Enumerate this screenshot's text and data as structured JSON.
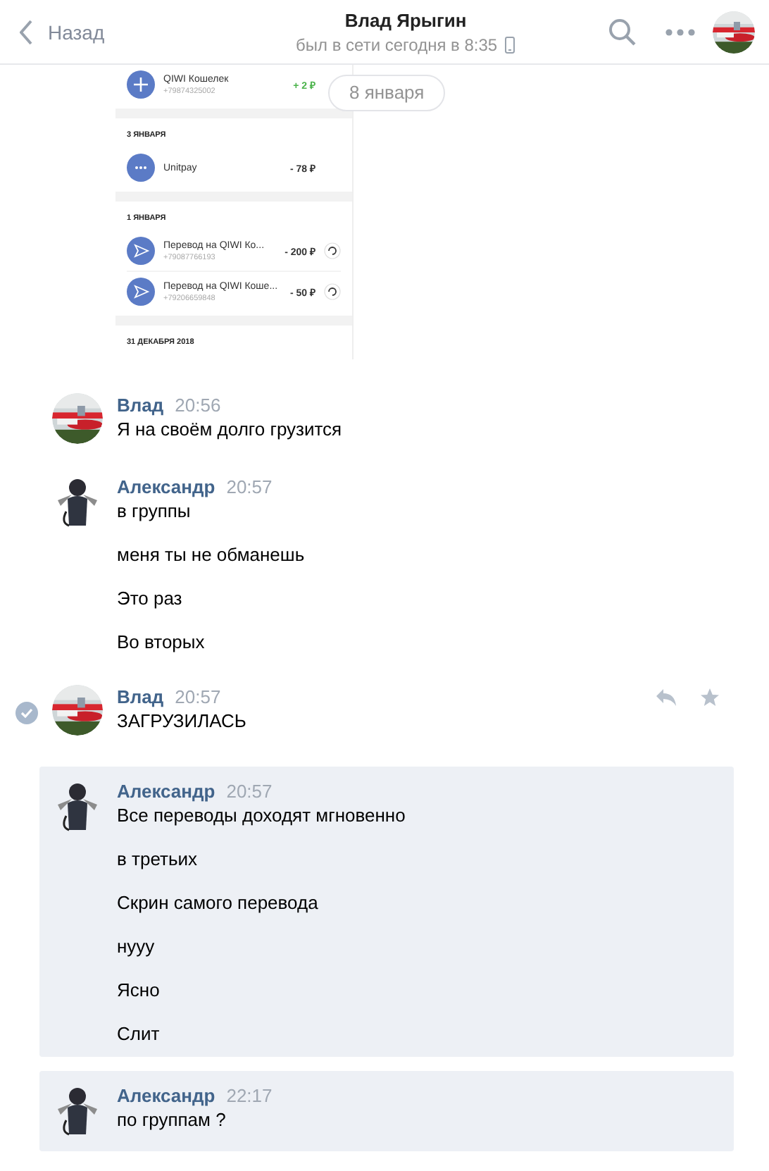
{
  "header": {
    "back": "Назад",
    "title": "Влад Ярыгин",
    "status": "был в сети сегодня в 8:35"
  },
  "date_pill": "8 января",
  "attachment": {
    "sections": [
      {
        "rows": [
          {
            "kind": "plus",
            "name": "QIWI Кошелек",
            "phone": "+79874325002",
            "amount": "+ 2 ₽",
            "income": true,
            "repeat": false
          }
        ]
      },
      {
        "date": "3 ЯНВАРЯ",
        "rows": [
          {
            "kind": "dots",
            "name": "Unitpay",
            "amount": "- 78 ₽",
            "income": false,
            "repeat": false
          }
        ]
      },
      {
        "date": "1 ЯНВАРЯ",
        "rows": [
          {
            "kind": "send",
            "name": "Перевод на QIWI Ко...",
            "phone": "+79087766193",
            "amount": "- 200 ₽",
            "income": false,
            "repeat": true
          },
          {
            "kind": "send",
            "name": "Перевод на QIWI Коше...",
            "phone": "+79206659848",
            "amount": "- 50 ₽",
            "income": false,
            "repeat": true
          }
        ]
      },
      {
        "date": "31 ДЕКАБРЯ 2018"
      }
    ]
  },
  "groups": [
    {
      "author": "Влад",
      "time": "20:56",
      "selected": false,
      "unread": false,
      "messages": [
        "Я на своём долго грузится"
      ]
    },
    {
      "kind": "figure",
      "author": "Александр",
      "time": "20:57",
      "selected": false,
      "unread": false,
      "messages": [
        "в группы",
        "меня ты не обманешь",
        "Это раз",
        "Во вторых"
      ]
    },
    {
      "author": "Влад",
      "time": "20:57",
      "selected": true,
      "unread": false,
      "messages": [
        "ЗАГРУЗИЛАСЬ"
      ]
    },
    {
      "kind": "figure",
      "author": "Александр",
      "time": "20:57",
      "selected": false,
      "unread": true,
      "messages": [
        "Все переводы доходят мгновенно",
        "в третьих",
        "Скрин самого перевода",
        "нууу",
        "Ясно",
        "Слит"
      ]
    },
    {
      "kind": "figure",
      "author": "Александр",
      "time": "22:17",
      "selected": false,
      "unread": true,
      "messages": [
        "по группам ?"
      ]
    }
  ]
}
